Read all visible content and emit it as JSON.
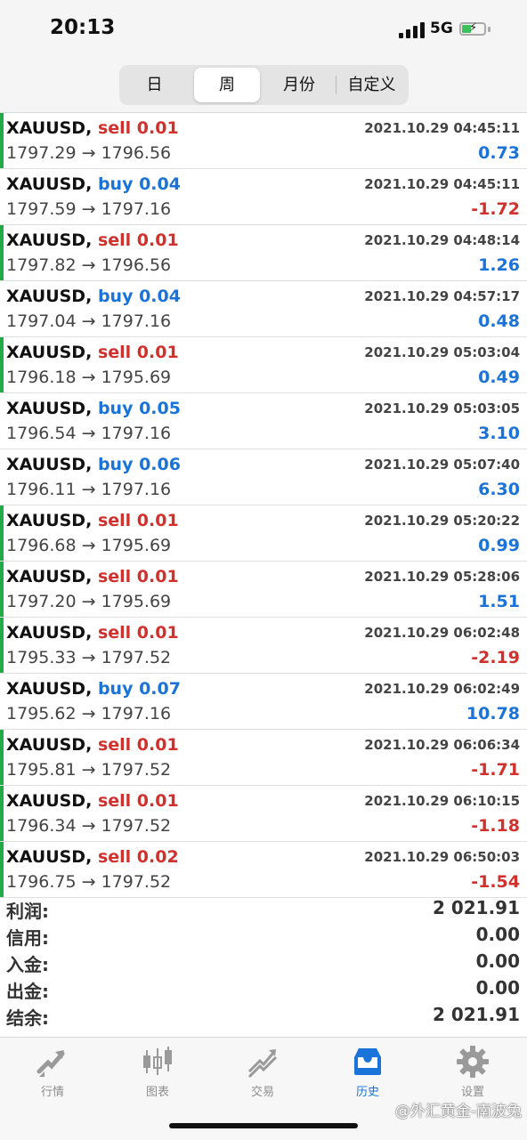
{
  "status": {
    "time": "20:13",
    "network": "5G"
  },
  "periods": [
    "日",
    "周",
    "月份",
    "自定义"
  ],
  "active_period": 1,
  "trades": [
    {
      "symbol": "XAUUSD,",
      "side": "sell",
      "lots": "0.01",
      "time": "2021.10.29 04:45:11",
      "open": "1797.29",
      "close": "1796.56",
      "profit": "0.73"
    },
    {
      "symbol": "XAUUSD,",
      "side": "buy",
      "lots": "0.04",
      "time": "2021.10.29 04:45:11",
      "open": "1797.59",
      "close": "1797.16",
      "profit": "-1.72"
    },
    {
      "symbol": "XAUUSD,",
      "side": "sell",
      "lots": "0.01",
      "time": "2021.10.29 04:48:14",
      "open": "1797.82",
      "close": "1796.56",
      "profit": "1.26"
    },
    {
      "symbol": "XAUUSD,",
      "side": "buy",
      "lots": "0.04",
      "time": "2021.10.29 04:57:17",
      "open": "1797.04",
      "close": "1797.16",
      "profit": "0.48"
    },
    {
      "symbol": "XAUUSD,",
      "side": "sell",
      "lots": "0.01",
      "time": "2021.10.29 05:03:04",
      "open": "1796.18",
      "close": "1795.69",
      "profit": "0.49"
    },
    {
      "symbol": "XAUUSD,",
      "side": "buy",
      "lots": "0.05",
      "time": "2021.10.29 05:03:05",
      "open": "1796.54",
      "close": "1797.16",
      "profit": "3.10"
    },
    {
      "symbol": "XAUUSD,",
      "side": "buy",
      "lots": "0.06",
      "time": "2021.10.29 05:07:40",
      "open": "1796.11",
      "close": "1797.16",
      "profit": "6.30"
    },
    {
      "symbol": "XAUUSD,",
      "side": "sell",
      "lots": "0.01",
      "time": "2021.10.29 05:20:22",
      "open": "1796.68",
      "close": "1795.69",
      "profit": "0.99"
    },
    {
      "symbol": "XAUUSD,",
      "side": "sell",
      "lots": "0.01",
      "time": "2021.10.29 05:28:06",
      "open": "1797.20",
      "close": "1795.69",
      "profit": "1.51"
    },
    {
      "symbol": "XAUUSD,",
      "side": "sell",
      "lots": "0.01",
      "time": "2021.10.29 06:02:48",
      "open": "1795.33",
      "close": "1797.52",
      "profit": "-2.19"
    },
    {
      "symbol": "XAUUSD,",
      "side": "buy",
      "lots": "0.07",
      "time": "2021.10.29 06:02:49",
      "open": "1795.62",
      "close": "1797.16",
      "profit": "10.78"
    },
    {
      "symbol": "XAUUSD,",
      "side": "sell",
      "lots": "0.01",
      "time": "2021.10.29 06:06:34",
      "open": "1795.81",
      "close": "1797.52",
      "profit": "-1.71"
    },
    {
      "symbol": "XAUUSD,",
      "side": "sell",
      "lots": "0.01",
      "time": "2021.10.29 06:10:15",
      "open": "1796.34",
      "close": "1797.52",
      "profit": "-1.18"
    },
    {
      "symbol": "XAUUSD,",
      "side": "sell",
      "lots": "0.02",
      "time": "2021.10.29 06:50:03",
      "open": "1796.75",
      "close": "1797.52",
      "profit": "-1.54"
    }
  ],
  "summary": [
    {
      "label": "利润:",
      "value": "2 021.91"
    },
    {
      "label": "信用:",
      "value": "0.00"
    },
    {
      "label": "入金:",
      "value": "0.00"
    },
    {
      "label": "出金:",
      "value": "0.00"
    },
    {
      "label": "结余:",
      "value": "2 021.91"
    }
  ],
  "tabs": [
    {
      "label": "行情",
      "icon": "quotes-icon"
    },
    {
      "label": "图表",
      "icon": "chart-icon"
    },
    {
      "label": "交易",
      "icon": "trade-icon"
    },
    {
      "label": "历史",
      "icon": "history-icon"
    },
    {
      "label": "设置",
      "icon": "settings-icon"
    }
  ],
  "active_tab": 3,
  "watermark": "@外汇黄金-南波兔",
  "colors": {
    "sell": "#d0312d",
    "buy": "#1a73d9",
    "profit_pos": "#1a73d9",
    "profit_neg": "#d0312d",
    "sell_marker": "#22aa44",
    "active": "#1a73d9",
    "inactive_icon": "#9a9a9a"
  }
}
